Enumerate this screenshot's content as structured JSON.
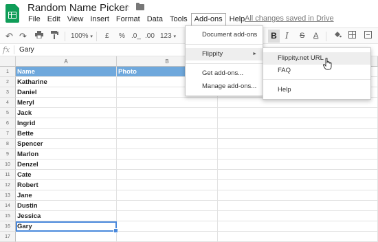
{
  "app": {
    "title": "Random Name Picker",
    "saved_status": "All changes saved in Drive"
  },
  "menubar": [
    "File",
    "Edit",
    "View",
    "Insert",
    "Format",
    "Data",
    "Tools",
    "Add-ons",
    "Help"
  ],
  "toolbar": {
    "zoom": "100%",
    "currency": "£",
    "percent": "%",
    "dec_decrease": ".0_",
    "dec_increase": ".00",
    "more_formats": "123",
    "bold": "B",
    "italic": "I",
    "strike": "S",
    "text_color": "A"
  },
  "formula_bar": {
    "fx_label": "fx",
    "value": "Gary"
  },
  "columns": [
    "A",
    "B"
  ],
  "rows": [
    {
      "num": "1",
      "a": "Name",
      "b": "Photo"
    },
    {
      "num": "2",
      "a": "Katharine",
      "b": ""
    },
    {
      "num": "3",
      "a": "Daniel",
      "b": ""
    },
    {
      "num": "4",
      "a": "Meryl",
      "b": ""
    },
    {
      "num": "5",
      "a": "Jack",
      "b": ""
    },
    {
      "num": "6",
      "a": "Ingrid",
      "b": ""
    },
    {
      "num": "7",
      "a": "Bette",
      "b": ""
    },
    {
      "num": "8",
      "a": "Spencer",
      "b": ""
    },
    {
      "num": "9",
      "a": "Marlon",
      "b": ""
    },
    {
      "num": "10",
      "a": "Denzel",
      "b": ""
    },
    {
      "num": "11",
      "a": "Cate",
      "b": ""
    },
    {
      "num": "12",
      "a": "Robert",
      "b": ""
    },
    {
      "num": "13",
      "a": "Jane",
      "b": ""
    },
    {
      "num": "14",
      "a": "Dustin",
      "b": ""
    },
    {
      "num": "15",
      "a": "Jessica",
      "b": ""
    },
    {
      "num": "16",
      "a": "Gary",
      "b": ""
    },
    {
      "num": "17",
      "a": "",
      "b": ""
    }
  ],
  "addons_menu": {
    "document_addons": "Document add-ons",
    "flippity": "Flippity",
    "get_addons": "Get add-ons...",
    "manage_addons": "Manage add-ons..."
  },
  "flippity_menu": {
    "url": "Flippity.net URL",
    "faq": "FAQ",
    "help": "Help"
  },
  "colors": {
    "header_fill": "#6fa8dc",
    "selection": "#4a89dc",
    "sheets_green": "#0f9d58"
  }
}
